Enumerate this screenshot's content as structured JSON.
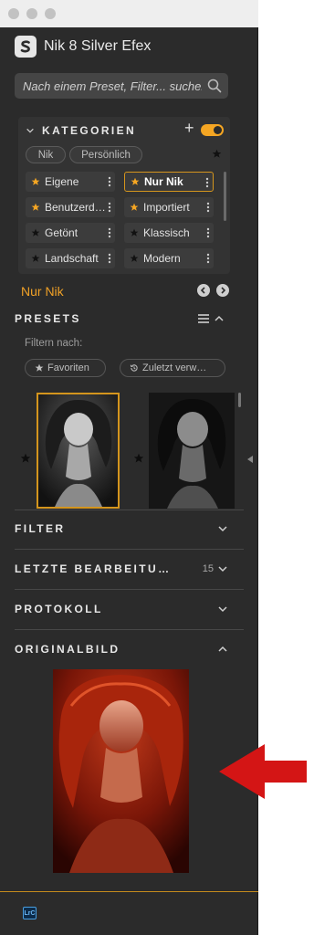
{
  "app": {
    "title": "Nik 8 Silver Efex",
    "logo_icon": "silver-efex-logo",
    "accent_color": "#f5a623"
  },
  "search": {
    "placeholder": "Nach einem Preset, Filter... suchen",
    "icon": "search-icon"
  },
  "kategorien": {
    "label": "KATEGORIEN",
    "toggle_on": true,
    "pills": [
      "Nik",
      "Persönlich"
    ],
    "items": [
      {
        "label": "Eigene",
        "starred": true,
        "selected": false
      },
      {
        "label": "Nur Nik",
        "starred": true,
        "selected": true
      },
      {
        "label": "Benutzerd…",
        "starred": true,
        "selected": false
      },
      {
        "label": "Importiert",
        "starred": true,
        "selected": false
      },
      {
        "label": "Getönt",
        "starred": false,
        "selected": false
      },
      {
        "label": "Klassisch",
        "starred": false,
        "selected": false
      },
      {
        "label": "Landschaft",
        "starred": false,
        "selected": false
      },
      {
        "label": "Modern",
        "starred": false,
        "selected": false
      }
    ]
  },
  "current_category": "Nur Nik",
  "presets": {
    "label": "PRESETS",
    "filter_label": "Filtern nach:",
    "favorites_button": "Favoriten",
    "recent_button": "Zuletzt verw…"
  },
  "sections": {
    "filter": {
      "label": "FILTER"
    },
    "history": {
      "label": "LETZTE BEARBEITU…",
      "count": "15"
    },
    "protocol": {
      "label": "PROTOKOLL"
    },
    "original": {
      "label": "ORIGINALBILD"
    }
  },
  "footer": {
    "lrc_badge": "LrC"
  }
}
